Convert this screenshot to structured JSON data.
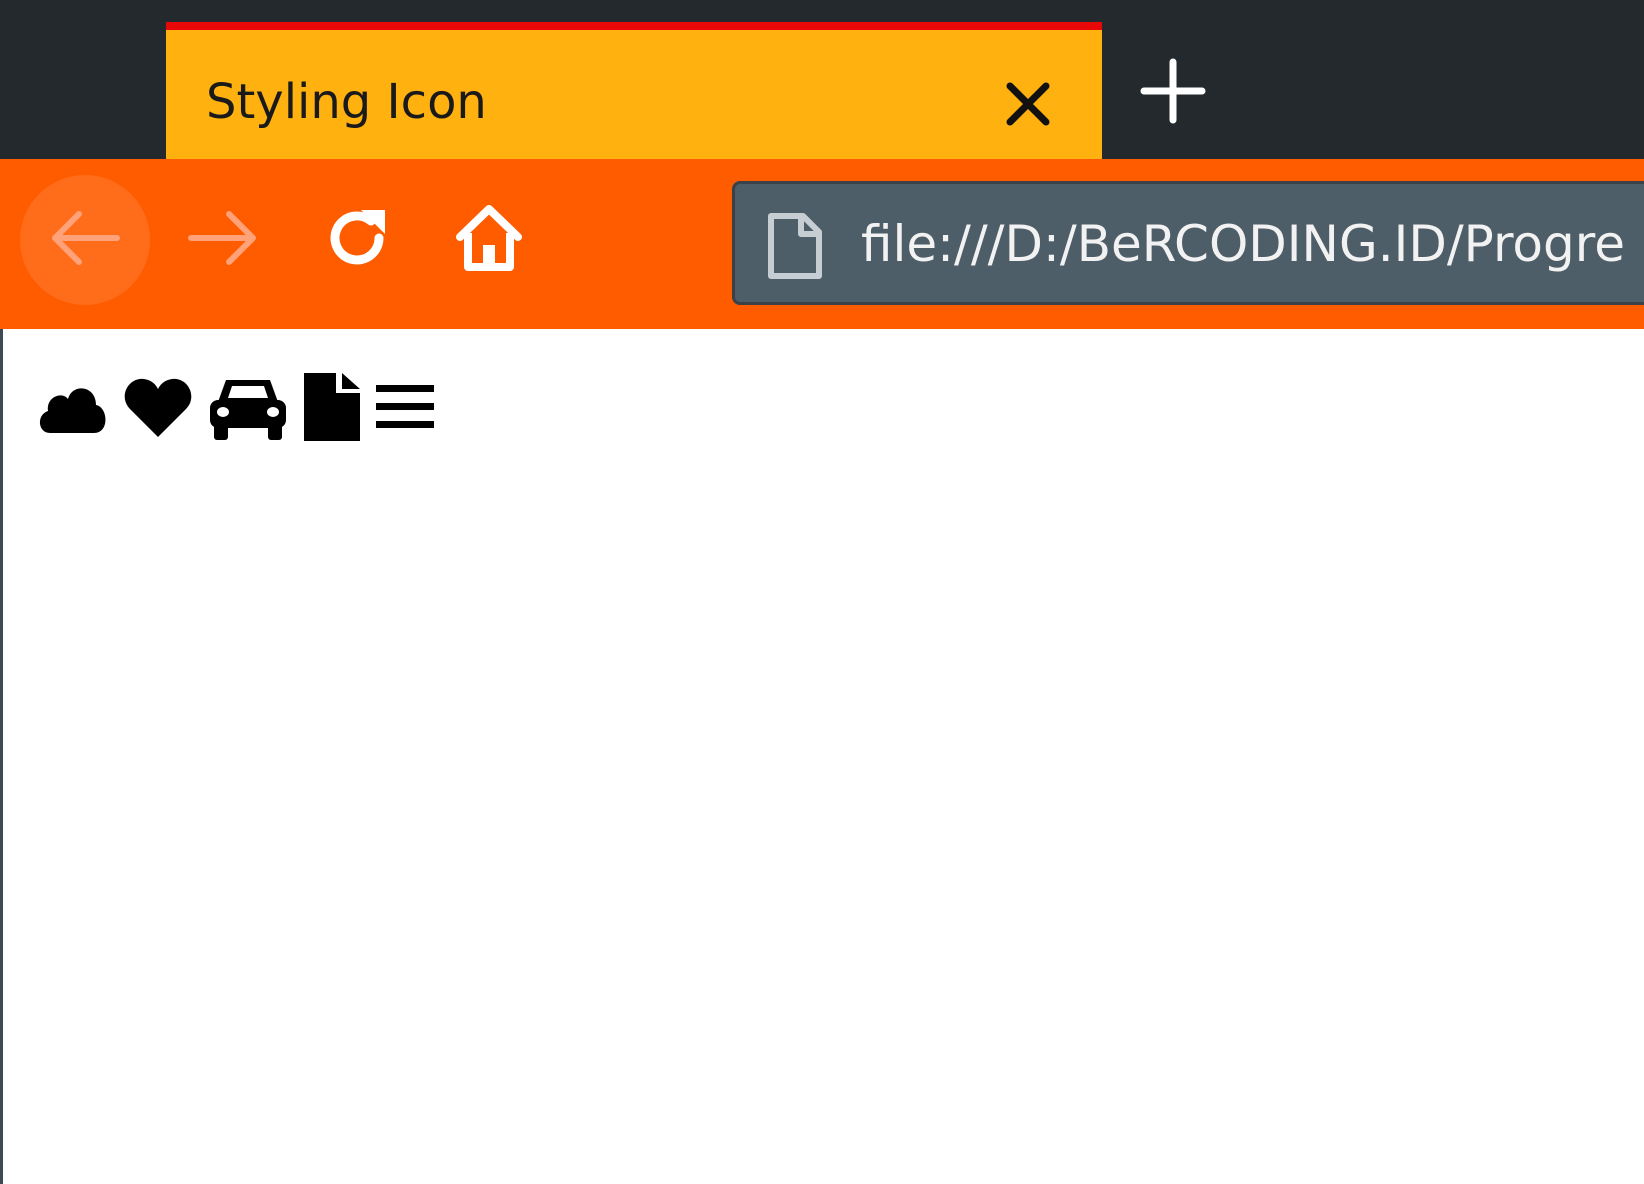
{
  "browser": {
    "tab": {
      "title": "Styling Icon",
      "close_icon": "close-icon"
    },
    "new_tab_icon": "plus-icon",
    "nav": {
      "back_icon": "arrow-left-icon",
      "forward_icon": "arrow-right-icon",
      "reload_icon": "reload-icon",
      "home_icon": "home-icon"
    },
    "address_bar": {
      "page_icon": "document-icon",
      "url": "file:///D:/BeRCODING.ID/Progre"
    }
  },
  "page": {
    "icons": [
      "cloud-icon",
      "heart-icon",
      "car-icon",
      "file-icon",
      "bars-icon"
    ]
  },
  "colors": {
    "tab_strip": "#24292d",
    "active_tab": "#ffb10f",
    "active_tab_indicator": "#e80808",
    "toolbar": "#ff5c00",
    "url_field": "#4e5e68",
    "icons": "#000000"
  }
}
